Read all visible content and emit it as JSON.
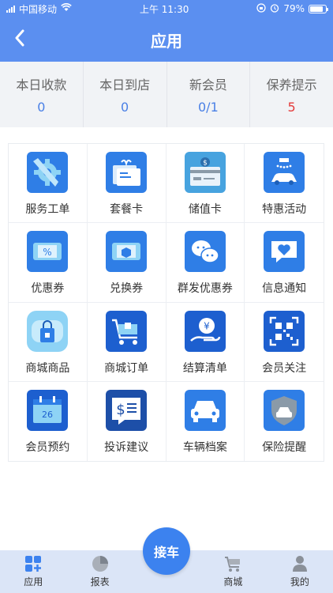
{
  "status_bar": {
    "carrier": "中国移动",
    "time": "上午 11:30",
    "battery": "79%"
  },
  "nav": {
    "title": "应用"
  },
  "stats": [
    {
      "label": "本日收款",
      "value": "0",
      "color": "#4a80e6"
    },
    {
      "label": "本日到店",
      "value": "0",
      "color": "#4a80e6"
    },
    {
      "label": "新会员",
      "value": "0/1",
      "color": "#4a80e6"
    },
    {
      "label": "保养提示",
      "value": "5",
      "color": "#e43b3b"
    }
  ],
  "apps": [
    {
      "label": "服务工单",
      "icon": "wrench-gear-icon"
    },
    {
      "label": "套餐卡",
      "icon": "gift-card-icon"
    },
    {
      "label": "储值卡",
      "icon": "stored-value-card-icon"
    },
    {
      "label": "特惠活动",
      "icon": "car-wash-icon"
    },
    {
      "label": "优惠券",
      "icon": "percent-coupon-icon"
    },
    {
      "label": "兑换券",
      "icon": "exchange-coupon-icon"
    },
    {
      "label": "群发优惠券",
      "icon": "chat-bubbles-icon"
    },
    {
      "label": "信息通知",
      "icon": "heart-message-icon"
    },
    {
      "label": "商城商品",
      "icon": "shopping-bag-icon"
    },
    {
      "label": "商城订单",
      "icon": "shopping-cart-icon"
    },
    {
      "label": "结算清单",
      "icon": "yen-hand-icon"
    },
    {
      "label": "会员关注",
      "icon": "qr-code-icon"
    },
    {
      "label": "会员预约",
      "icon": "calendar-icon"
    },
    {
      "label": "投诉建议",
      "icon": "dollar-note-icon"
    },
    {
      "label": "车辆档案",
      "icon": "car-icon"
    },
    {
      "label": "保险提醒",
      "icon": "shield-car-icon"
    }
  ],
  "tabbar": {
    "app_label": "应用",
    "report_label": "报表",
    "center_label": "接车",
    "mall_label": "商城",
    "mine_label": "我的"
  },
  "colors": {
    "primary": "#5b8ff0",
    "accent": "#3c82ef",
    "warning": "#e43b3b"
  }
}
